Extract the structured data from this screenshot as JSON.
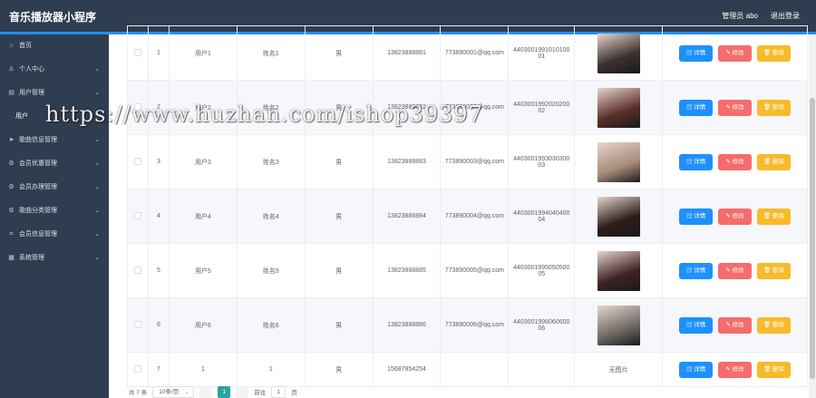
{
  "header": {
    "title": "音乐播放器小程序",
    "user": "管理员 abo",
    "logout": "退出登录"
  },
  "sidebar": {
    "items": [
      {
        "label": "首页",
        "icon": "home-icon",
        "glyph": "⌂",
        "chevron": false
      },
      {
        "label": "个人中心",
        "icon": "person-icon",
        "glyph": "♙",
        "chevron": true
      },
      {
        "label": "用户管理",
        "icon": "users-icon",
        "glyph": "▤",
        "chevron": true,
        "expanded": true,
        "sub": "用户"
      },
      {
        "label": "歌曲信息管理",
        "icon": "send-icon",
        "glyph": "➤",
        "chevron": true
      },
      {
        "label": "会员优惠管理",
        "icon": "coupon-icon",
        "glyph": "⚙",
        "chevron": true
      },
      {
        "label": "会员办理管理",
        "icon": "card-icon",
        "glyph": "⚙",
        "chevron": true
      },
      {
        "label": "歌曲分类管理",
        "icon": "category-icon",
        "glyph": "⚙",
        "chevron": true
      },
      {
        "label": "会员信息管理",
        "icon": "member-icon",
        "glyph": "⌗",
        "chevron": true
      },
      {
        "label": "系统管理",
        "icon": "system-icon",
        "glyph": "▦",
        "chevron": true
      }
    ]
  },
  "table": {
    "rows": [
      {
        "no": "1",
        "account": "用户1",
        "name": "姓名1",
        "gender": "男",
        "phone": "13823888881",
        "email": "773890001@qq.com",
        "idcard": "440300199101010001",
        "photo": "photo-1",
        "color": "#3b3030"
      },
      {
        "no": "2",
        "account": "用户2",
        "name": "姓名2",
        "gender": "男",
        "phone": "13823888882",
        "email": "773890002@qq.com",
        "idcard": "440300199202020002",
        "photo": "photo-2",
        "color": "#5a2e2a"
      },
      {
        "no": "3",
        "account": "用户3",
        "name": "姓名3",
        "gender": "男",
        "phone": "13823888883",
        "email": "773890003@qq.com",
        "idcard": "440300199303030003",
        "photo": "photo-3",
        "color": "#a88a7a"
      },
      {
        "no": "4",
        "account": "用户4",
        "name": "姓名4",
        "gender": "男",
        "phone": "13823888884",
        "email": "773890004@qq.com",
        "idcard": "440300199404040004",
        "photo": "photo-4",
        "color": "#2b1d1a"
      },
      {
        "no": "5",
        "account": "用户5",
        "name": "姓名5",
        "gender": "男",
        "phone": "13823888885",
        "email": "773890005@qq.com",
        "idcard": "440300199505050005",
        "photo": "photo-5",
        "color": "#3e2226"
      },
      {
        "no": "6",
        "account": "用户6",
        "name": "姓名6",
        "gender": "男",
        "phone": "13823888886",
        "email": "773890006@qq.com",
        "idcard": "440300199606060006",
        "photo": "photo-6",
        "color": "#6f6a66"
      },
      {
        "no": "7",
        "account": "1",
        "name": "1",
        "gender": "男",
        "phone": "15687954254",
        "email": "",
        "idcard": "",
        "photo": "",
        "noPhoto": "无图片",
        "color": ""
      }
    ],
    "actions": {
      "detail": "▤ 详情",
      "edit": "✎ 修改",
      "delete": "🗑 删除"
    }
  },
  "pagination": {
    "total": "共 7 条",
    "pageSize": "10条/页",
    "prev": "‹",
    "current": "1",
    "next": "›",
    "goto": "前往",
    "page": "1",
    "unit": "页"
  },
  "watermark": "https://www.huzhan.com/ishop39397"
}
